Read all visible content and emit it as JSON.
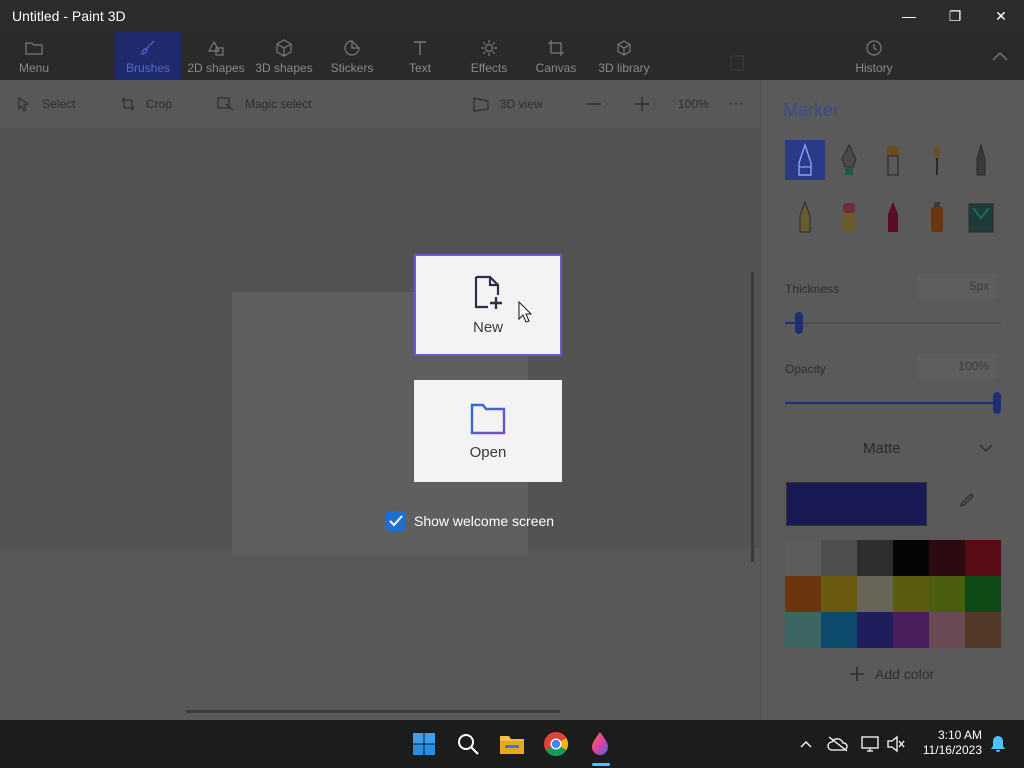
{
  "window": {
    "title": "Untitled - Paint 3D",
    "minimize_glyph": "—",
    "restore_glyph": "❐",
    "close_glyph": "✕"
  },
  "ribbon": {
    "menu": "Menu",
    "tabs": [
      {
        "label": "Brushes",
        "icon": "brush-icon",
        "active": true
      },
      {
        "label": "2D shapes",
        "icon": "shapes-icon"
      },
      {
        "label": "3D shapes",
        "icon": "cube-icon"
      },
      {
        "label": "Stickers",
        "icon": "sticker-icon"
      },
      {
        "label": "Text",
        "icon": "text-icon"
      },
      {
        "label": "Effects",
        "icon": "sun-icon"
      },
      {
        "label": "Canvas",
        "icon": "canvas-icon"
      },
      {
        "label": "3D library",
        "icon": "library-icon"
      }
    ],
    "history": "History"
  },
  "toolbar": {
    "select": "Select",
    "crop": "Crop",
    "magic_select": "Magic select",
    "view_3d": "3D view",
    "zoom": "100%",
    "more": "···"
  },
  "panel": {
    "title": "Marker",
    "thickness_label": "Thickness",
    "thickness_value": "5px",
    "thickness_level": 0.05,
    "opacity_label": "Opacity",
    "opacity_value": "100%",
    "opacity_level": 1.0,
    "finish": "Matte",
    "add_color": "Add color",
    "current_color": "#1a1a55",
    "palette": [
      "#5c5c5c",
      "#4f4f4f",
      "#2e2e2e",
      "#050505",
      "#2b0a12",
      "#5a0c14",
      "#6a3510",
      "#6b5a10",
      "#676554",
      "#5d5b0d",
      "#4a5c0d",
      "#0d4a15",
      "#3c6564",
      "#0d4a6b",
      "#1e1e5c",
      "#4a1e5c",
      "#6a4a55",
      "#52392a"
    ]
  },
  "dialog": {
    "new": "New",
    "open": "Open",
    "show_welcome": "Show welcome screen",
    "show_welcome_checked": true
  },
  "taskbar": {
    "time": "3:10 AM",
    "date": "11/16/2023"
  }
}
